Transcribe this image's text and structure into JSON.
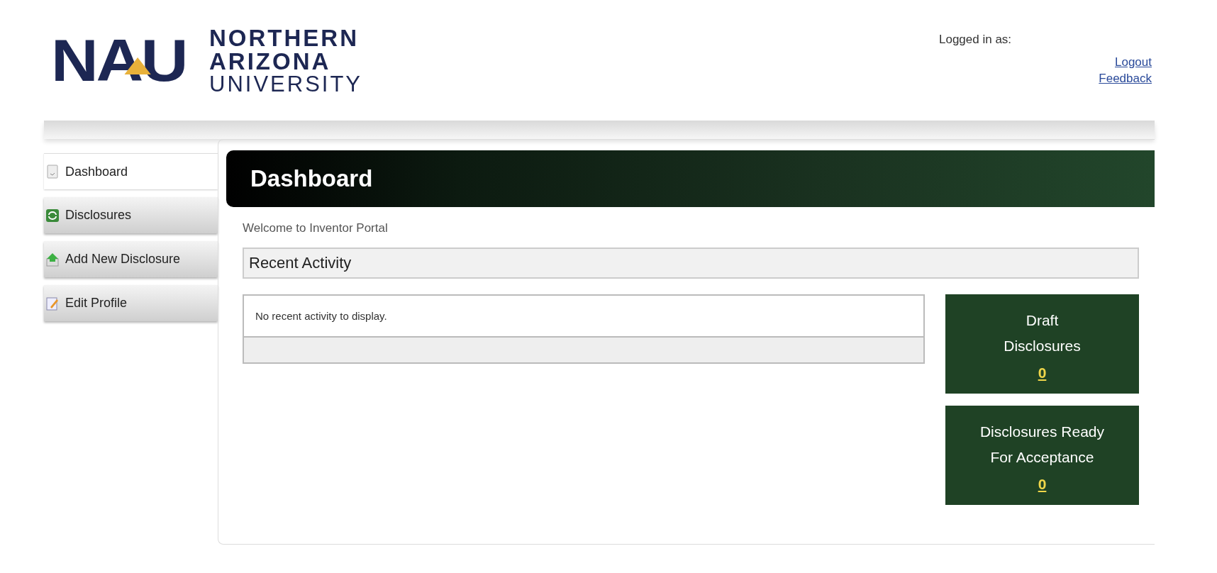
{
  "header": {
    "logo": {
      "mark": "NAU",
      "lines": [
        "NORTHERN",
        "ARIZONA",
        "UNIVERSITY"
      ]
    },
    "user_label": "Logged in as:",
    "links": [
      "Logout",
      "Feedback"
    ]
  },
  "sidebar": {
    "items": [
      {
        "label": "Dashboard",
        "kind": "dashboard",
        "selected": true
      },
      {
        "label": "Disclosures",
        "kind": "disclosures",
        "selected": false
      },
      {
        "label": "Add New Disclosure",
        "kind": "add",
        "selected": false
      },
      {
        "label": "Edit Profile",
        "kind": "edit",
        "selected": false
      }
    ]
  },
  "page": {
    "title": "Dashboard",
    "welcome": "Welcome to Inventor Portal",
    "section": "Recent Activity",
    "activity": {
      "message": "No recent activity to display."
    },
    "cards": [
      {
        "lines": [
          "Draft",
          "Disclosures"
        ],
        "count": "0"
      },
      {
        "lines": [
          "Disclosures Ready",
          "For Acceptance"
        ],
        "count": "0"
      }
    ]
  }
}
